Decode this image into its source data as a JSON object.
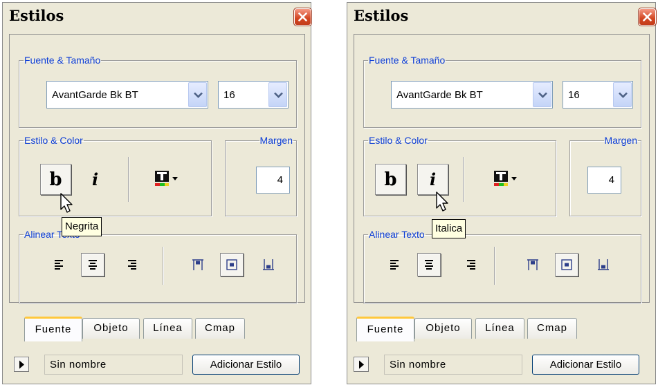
{
  "panels": [
    {
      "title": "Estilos",
      "font_group": {
        "legend": "Fuente & Tamaño",
        "font": "AvantGarde Bk BT",
        "size": "16"
      },
      "style_group": {
        "legend": "Estilo & Color",
        "bold": "b",
        "italic": "i"
      },
      "margin_group": {
        "legend": "Margen",
        "value": "4"
      },
      "align_group": {
        "legend": "Alinear Texto"
      },
      "tabs": [
        "Fuente",
        "Objeto",
        "Línea",
        "Cmap"
      ],
      "style_name": "Sin nombre",
      "add_button": "Adicionar Estilo",
      "tooltip": "Negrita",
      "pressed": {
        "bold": true,
        "italic": false
      }
    },
    {
      "title": "Estilos",
      "font_group": {
        "legend": "Fuente & Tamaño",
        "font": "AvantGarde Bk BT",
        "size": "16"
      },
      "style_group": {
        "legend": "Estilo & Color",
        "bold": "b",
        "italic": "i"
      },
      "margin_group": {
        "legend": "Margen",
        "value": "4"
      },
      "align_group": {
        "legend": "Alinear Texto"
      },
      "tabs": [
        "Fuente",
        "Objeto",
        "Línea",
        "Cmap"
      ],
      "style_name": "Sin nombre",
      "add_button": "Adicionar Estilo",
      "tooltip": "Italica",
      "pressed": {
        "bold": true,
        "italic": true
      }
    }
  ],
  "icons": {
    "close": "close-icon",
    "dropdown": "chevron-down-icon",
    "text_color": "text-color-icon",
    "align_left": "align-left-icon",
    "align_center": "align-center-icon",
    "align_right": "align-right-icon",
    "valign_top": "valign-top-icon",
    "valign_middle": "valign-middle-icon",
    "valign_bottom": "valign-bottom-icon",
    "expand": "play-icon",
    "cursor": "mouse-pointer-icon"
  },
  "colors": {
    "legend": "#0c3dd6",
    "panel": "#ece9d8",
    "close": "#d24621",
    "tab_highlight": "#ffc83c"
  }
}
